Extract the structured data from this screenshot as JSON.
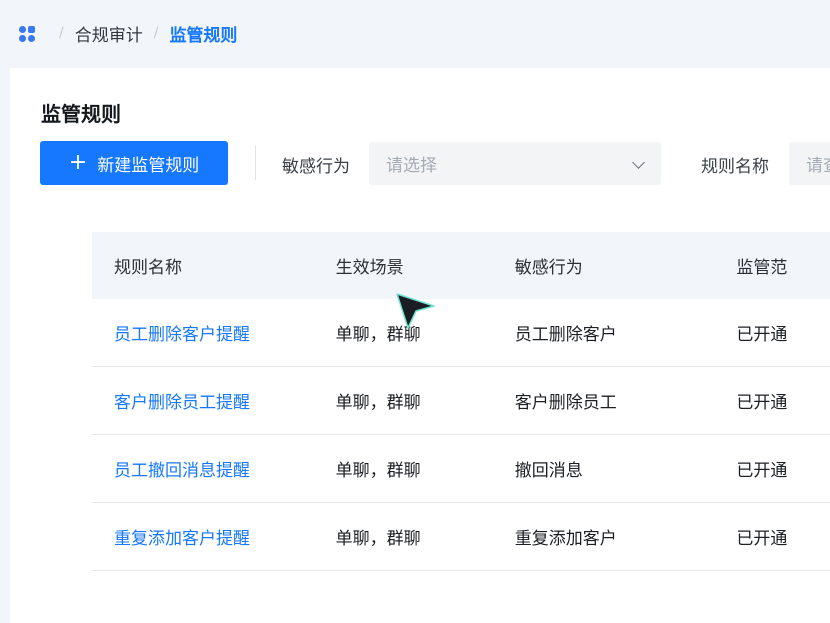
{
  "breadcrumb": {
    "items": [
      "合规审计",
      "监管规则"
    ],
    "separator": "/"
  },
  "page": {
    "title": "监管规则",
    "create_button": "新建监管规则"
  },
  "filters": {
    "sensitive_action_label": "敏感行为",
    "sensitive_action_placeholder": "请选择",
    "rule_name_label": "规则名称",
    "rule_name_placeholder": "请查"
  },
  "table": {
    "headers": [
      "规则名称",
      "生效场景",
      "敏感行为",
      "监管范"
    ],
    "rows": [
      [
        "员工删除客户提醒",
        "单聊，群聊",
        "员工删除客户",
        "已开通"
      ],
      [
        "客户删除员工提醒",
        "单聊，群聊",
        "客户删除员工",
        "已开通"
      ],
      [
        "员工撤回消息提醒",
        "单聊，群聊",
        "撤回消息",
        "已开通"
      ],
      [
        "重复添加客户提醒",
        "单聊，群聊",
        "重复添加客户",
        "已开通"
      ]
    ]
  },
  "colors": {
    "accent": "#1677ff",
    "background": "#f2f5fa"
  }
}
